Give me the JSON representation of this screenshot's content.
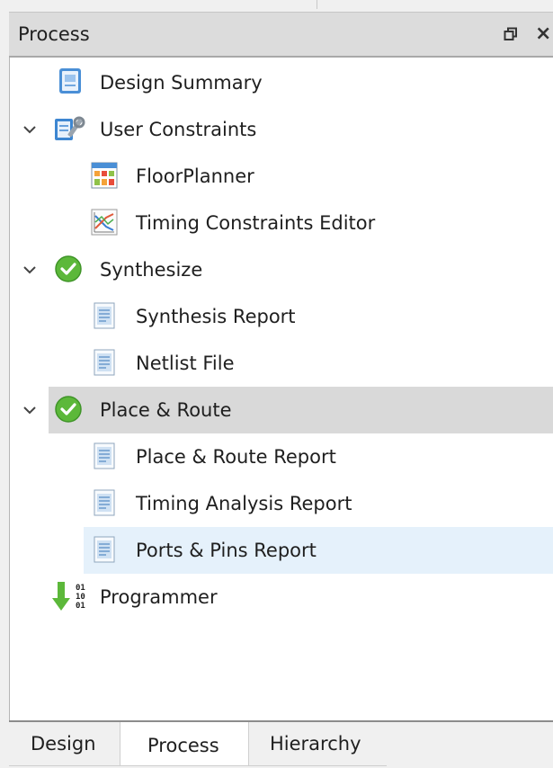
{
  "panel": {
    "title": "Process",
    "restore_icon": "restore-window-icon",
    "close_glyph": "×"
  },
  "tree": {
    "design_summary": {
      "label": "Design Summary",
      "icon": "design-summary-icon"
    },
    "user_constraints": {
      "label": "User Constraints",
      "icon": "user-constraints-icon",
      "expanded": true
    },
    "floorplanner": {
      "label": "FloorPlanner",
      "icon": "floorplanner-icon"
    },
    "timing_constraints_editor": {
      "label": "Timing Constraints Editor",
      "icon": "timing-constraints-icon"
    },
    "synthesize": {
      "label": "Synthesize",
      "icon": "check-circle-icon",
      "status": "success",
      "expanded": true
    },
    "synthesis_report": {
      "label": "Synthesis Report",
      "icon": "report-document-icon"
    },
    "netlist_file": {
      "label": "Netlist File",
      "icon": "report-document-icon"
    },
    "place_route": {
      "label": "Place & Route",
      "icon": "check-circle-icon",
      "status": "success",
      "expanded": true,
      "selected": true
    },
    "place_route_report": {
      "label": "Place & Route Report",
      "icon": "report-document-icon"
    },
    "timing_analysis_report": {
      "label": "Timing Analysis Report",
      "icon": "report-document-icon"
    },
    "ports_pins_report": {
      "label": "Ports & Pins Report",
      "icon": "report-document-icon",
      "hovered": true
    },
    "programmer": {
      "label": "Programmer",
      "icon": "programmer-download-icon"
    }
  },
  "tabs": [
    {
      "label": "Design",
      "active": false
    },
    {
      "label": "Process",
      "active": true
    },
    {
      "label": "Hierarchy",
      "active": false
    }
  ],
  "colors": {
    "success_green": "#5cb83a",
    "selection_gray": "#d9d9d9",
    "hover_blue": "#e5f1fb",
    "title_bar": "#dcdcdc"
  }
}
